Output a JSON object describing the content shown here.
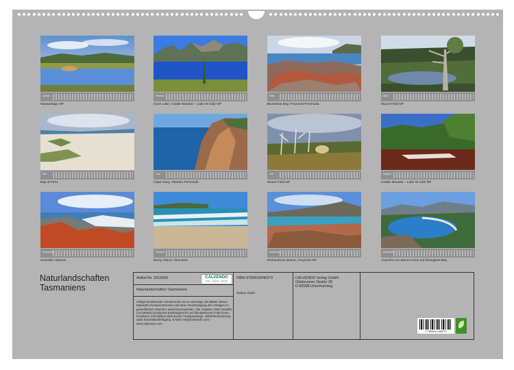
{
  "calendar": {
    "title_line1": "Naturlandschaften",
    "title_line2": "Tasmaniens",
    "months": [
      {
        "name": "Januar",
        "caption": "Narawntapu NP"
      },
      {
        "name": "Februar",
        "caption": "Dove Lake, Cradle Moutain – Lake St Clair NP"
      },
      {
        "name": "März",
        "caption": "Bluestone Bay, Freycinet Peninsula"
      },
      {
        "name": "April",
        "caption": "Mount Field NP"
      },
      {
        "name": "Mai",
        "caption": "Bay of Fires"
      },
      {
        "name": "Juni",
        "caption": "Cape Hauy, Tasman Peninsula"
      },
      {
        "name": "Juli",
        "caption": "Mount Field NP"
      },
      {
        "name": "August",
        "caption": "Cradle Moutain – Lake St Clair NP"
      },
      {
        "name": "September",
        "caption": "Granville Harbour"
      },
      {
        "name": "Oktober",
        "caption": "Bruny Island, Tasmania"
      },
      {
        "name": "November",
        "caption": "Richardsons Beach, Freycinet NP"
      },
      {
        "name": "Dezember",
        "caption": "Aussicht von Mount Amos auf Wineglass Bay"
      }
    ]
  },
  "info": {
    "article_no": "Artikel-Nr. 2019269",
    "product_title": "Naturlandschaften Tasmaniens",
    "isbn": "ISBN 9783516046373",
    "author": "Sidney Smith",
    "publisher_line1": "CALVENDO Verlag GmbH",
    "publisher_line2": "Ottobrunner Straße 39",
    "publisher_line3": "D-82008 Unterhaching",
    "notice": "Infolge bestehender Schutzrechte ist es untersagt, die Blätter dieses Kalenders herauszutrennen und ohne Genehmigung des Verlages zu gewerblichen Zwecken weiterzuverwenden. Alle Angaben ohne Gewähr. CALVENDO produziert bedarfsgerecht und klimabewusst in DE & EU. Positivere CO2-Bilanz dank kurzer Transportwege. Abfall-Reduzierung dank Einzelstückfertigung. E-Mail: info@calvendo.com – www.calvendo.com",
    "logo_text": "CALVENDO",
    "logo_sub": "Verlag · Calendar · Kalender",
    "barcode_number": "9 783516 046373"
  }
}
